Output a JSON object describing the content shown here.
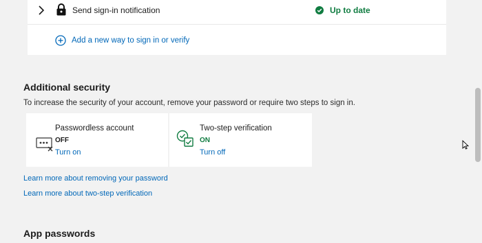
{
  "signin": {
    "row_label": "Send sign-in notification",
    "status": "Up to date",
    "status_color": "#107c41",
    "add_method": "Add a new way to sign in or verify"
  },
  "additional": {
    "heading": "Additional security",
    "description": "To increase the security of your account, remove your password or require two steps to sign in.",
    "cards": [
      {
        "title": "Passwordless account",
        "state": "OFF",
        "action": "Turn on",
        "icon": "password-dots-icon"
      },
      {
        "title": "Two-step verification",
        "state": "ON",
        "action": "Turn off",
        "icon": "two-step-check-icon",
        "state_color": "#107c41"
      }
    ],
    "links": [
      "Learn more about removing your password",
      "Learn more about two-step verification"
    ]
  },
  "app_passwords": {
    "heading": "App passwords"
  },
  "colors": {
    "accent": "#0067b8",
    "success": "#107c41",
    "background": "#f2f2f2"
  }
}
